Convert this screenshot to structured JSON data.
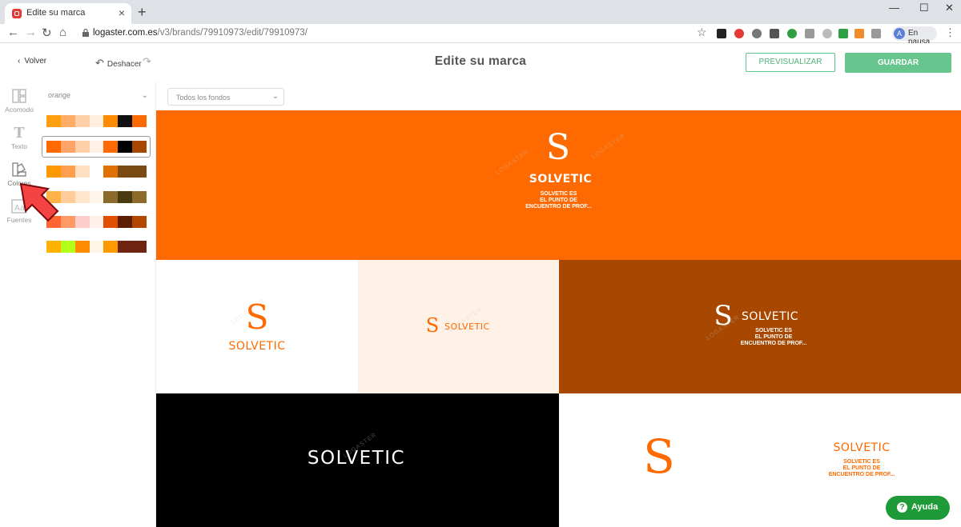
{
  "browser": {
    "tab_title": "Edite su marca",
    "url_domain": "logaster.com.es",
    "url_path": "/v3/brands/79910973/edit/79910973/",
    "profile_initial": "A",
    "profile_label": "En pausa"
  },
  "header": {
    "back_label": "Volver",
    "undo_label": "Deshacer",
    "title": "Edite su marca",
    "preview_label": "PREVISUALIZAR",
    "save_label": "GUARDAR"
  },
  "sidebar": {
    "tools": [
      {
        "label": "Acomodo",
        "icon": "layout-icon"
      },
      {
        "label": "Texto",
        "icon": "text-icon"
      },
      {
        "label": "Colores",
        "icon": "color-palette-icon"
      },
      {
        "label": "Fuentes",
        "icon": "font-icon"
      }
    ],
    "color_select_value": "orange",
    "palettes": [
      [
        "#ff9f0f",
        "#ffad66",
        "#ffd0a8",
        "#ffeedd",
        "#ff8c00",
        "#111111",
        "#ff6a00"
      ],
      [
        "#ff6a00",
        "#ffa366",
        "#ffcfa8",
        "#fff1e6",
        "#ff6a00",
        "#000000",
        "#a84800"
      ],
      [
        "#ff9900",
        "#ff9f4d",
        "#ffe0c2",
        "#ffffff",
        "#e07000",
        "#7a4a14",
        "#7a4a14"
      ],
      [
        "#ffb347",
        "#ffcc99",
        "#ffe5cc",
        "#fff5eb",
        "#8c6a2a",
        "#4a3a10",
        "#8c6a2a"
      ],
      [
        "#ff6633",
        "#ff9966",
        "#ffcccc",
        "#fff0ea",
        "#e05000",
        "#5c1e00",
        "#b34700"
      ],
      [
        "#ffb300",
        "#b3ff1a",
        "#ff8c00",
        "#fff5e6",
        "#ff9900",
        "#6e2410",
        "#6e2410"
      ]
    ]
  },
  "filter": {
    "value": "Todos los fondos"
  },
  "brand": {
    "initial": "S",
    "name": "SOLVETIC",
    "slogan_line1": "SOLVETIC ES",
    "slogan_line2": "EL PUNTO DE",
    "slogan_line3": "ENCUENTRO DE PROF...",
    "watermark": "LOGASTER"
  },
  "colors": {
    "orange": "#ff6a00",
    "cream": "#fff1e6",
    "brown": "#a84800",
    "black": "#000000",
    "accent_green": "#67c58e",
    "help_green": "#1e9a39"
  },
  "help": {
    "label": "Ayuda"
  }
}
